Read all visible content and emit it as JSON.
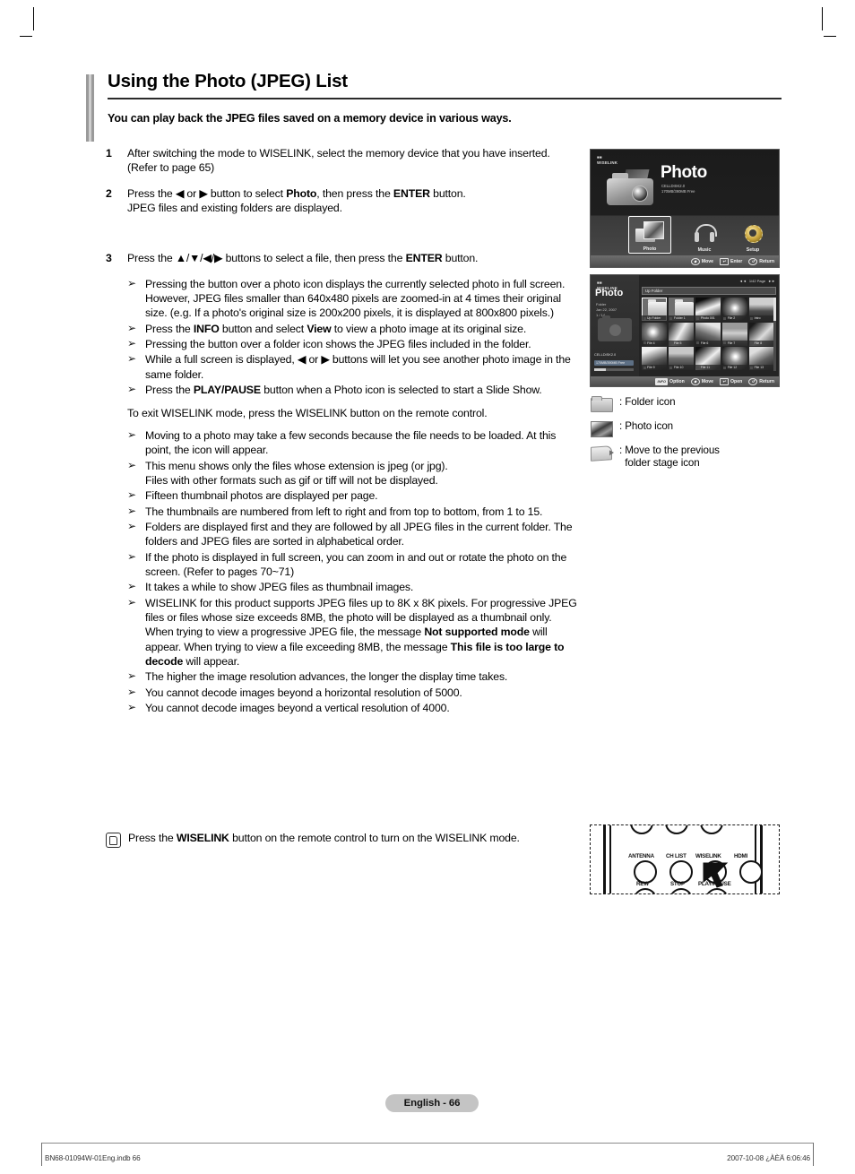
{
  "header": {
    "title": "Using the Photo (JPEG) List",
    "intro": "You can play back the JPEG files saved on a memory device in various ways."
  },
  "steps": [
    {
      "num": "1",
      "text": "After switching the mode to WISELINK, select the memory device that you have inserted. (Refer to page 65)"
    },
    {
      "num": "2",
      "text": "Press the ◀ or ▶ button to select Photo, then press the ENTER button. JPEG files and existing folders are displayed."
    },
    {
      "num": "3",
      "text": "Press the ▲/▼/◀/▶ buttons to select a file, then press the ENTER button."
    }
  ],
  "bullets_group_one": [
    "Pressing the button over a photo icon displays the currently selected photo in full screen. However, JPEG files smaller than 640x480 pixels are zoomed-in at 4 times their original size. (e.g. If a photo's original size is 200x200 pixels, it is displayed at 800x800 pixels.)",
    "Press the INFO button and select View to view a photo image at its original size.",
    "Pressing the button over a folder icon shows the JPEG files included in the folder.",
    "While a full screen is displayed, ◀ or ▶ buttons will let you see another photo image in the same folder.",
    "Press the PLAY/PAUSE button when a Photo icon is selected to start a Slide Show."
  ],
  "exit_paragraph": "To exit WISELINK mode, press the WISELINK button on the remote control.",
  "bullets_group_two": [
    "Moving to a photo may take a few seconds because the file needs to be loaded. At this point, the icon will appear.",
    "This menu shows only the files whose extension is jpeg (or jpg). Files with other formats such as gif or tiff will not be displayed.",
    "Fifteen thumbnail photos are displayed per page.",
    "The thumbnails are numbered from left to right and from top to bottom, from 1 to 15.",
    "Folders are displayed first and they are followed by all JPEG files in the current folder. The folders and JPEG files are sorted in alphabetical order.",
    "If the photo is displayed in full screen, you can zoom in and out or rotate the photo on the screen. (Refer to pages 70~71)",
    "It takes a while to show JPEG files as thumbnail images.",
    "WISELINK for this product supports JPEG files up to 8K x 8K pixels. For progressive JPEG files or files whose size exceeds 8MB, the photo will be displayed as a thumbnail only. When trying to view a progressive JPEG file, the message Not supported mode will appear. When trying to view a file exceeding 8MB, the message This file is too large to decode will appear.",
    "The higher the image resolution advances, the longer the display time takes.",
    "You cannot decode images beyond a horizontal resolution of 5000.",
    "You cannot decode images beyond a vertical resolution of 4000."
  ],
  "note": {
    "icon": "note-hand-icon",
    "text": "Press the WISELINK button on the remote control to turn on the WISELINK mode."
  },
  "screenshot_menu": {
    "logo": "WISELINK",
    "heading": "Photo",
    "device_lines": [
      "CELLDISK2.0",
      "170MB/390MB Free"
    ],
    "icons": [
      {
        "label": "Photo",
        "selected": true
      },
      {
        "label": "Music",
        "selected": false
      },
      {
        "label": "Setup",
        "selected": false
      }
    ],
    "statusbar": [
      {
        "key": "◆",
        "label": "Move"
      },
      {
        "key": "↵",
        "label": "Enter"
      },
      {
        "key": "↺",
        "label": "Return"
      }
    ]
  },
  "screenshot_browser": {
    "logo": "WISELINK",
    "rail_title": "Photo",
    "rail_meta": [
      "Folder",
      "Jan 22, 2007",
      "1 / 14"
    ],
    "rail_device": [
      "CELLDISK2.0"
    ],
    "rail_free": "170MB/390MB Free",
    "pager": "1/42 Page",
    "upfolder_label": "Up Folder",
    "cells": [
      {
        "label": "Up Folder",
        "kind": "folder",
        "selected": true
      },
      {
        "label": "Folder 1",
        "kind": "folder",
        "selected": false
      },
      {
        "label": "Photo 001",
        "kind": "photo",
        "art": "p1"
      },
      {
        "label": "File 2",
        "kind": "photo",
        "art": "p2"
      },
      {
        "label": "Intro",
        "kind": "photo",
        "art": "p3"
      },
      {
        "label": "File 4",
        "kind": "photo",
        "art": "p4"
      },
      {
        "label": "File 5",
        "kind": "photo",
        "art": "p5"
      },
      {
        "label": "File 6",
        "kind": "photo",
        "art": "p6"
      },
      {
        "label": "File 7",
        "kind": "photo",
        "art": "p7"
      },
      {
        "label": "File 8",
        "kind": "photo",
        "art": "p8"
      },
      {
        "label": "File 9",
        "kind": "photo",
        "art": "p9"
      },
      {
        "label": "File 10",
        "kind": "photo",
        "art": "p10"
      },
      {
        "label": "File 11",
        "kind": "photo",
        "art": "p11"
      },
      {
        "label": "File 12",
        "kind": "photo",
        "art": "p12"
      },
      {
        "label": "File 13",
        "kind": "photo",
        "art": "p13"
      }
    ],
    "statusbar": [
      {
        "key": "INFO",
        "label": "Option"
      },
      {
        "key": "◆",
        "label": "Move"
      },
      {
        "key": "↵",
        "label": "Open"
      },
      {
        "key": "↺",
        "label": "Return"
      }
    ]
  },
  "legend": [
    {
      "icon": "folder-icon",
      "text": ": Folder icon"
    },
    {
      "icon": "photo-icon",
      "text": ": Photo icon"
    },
    {
      "icon": "up-folder-icon",
      "text": ": Move to the previous folder stage icon"
    }
  ],
  "remote": {
    "top_labels": [
      "ANTENNA",
      "CH LIST",
      "WISELINK",
      "HDMI"
    ],
    "bottom_labels": [
      "REW",
      "STOP",
      "PLAY/PAUSE"
    ]
  },
  "footer": {
    "page_badge": "English - 66",
    "left": "BN68-01094W-01Eng.indb   66",
    "right": "2007-10-08   ¿ÀÈÄ 6:06:46"
  }
}
